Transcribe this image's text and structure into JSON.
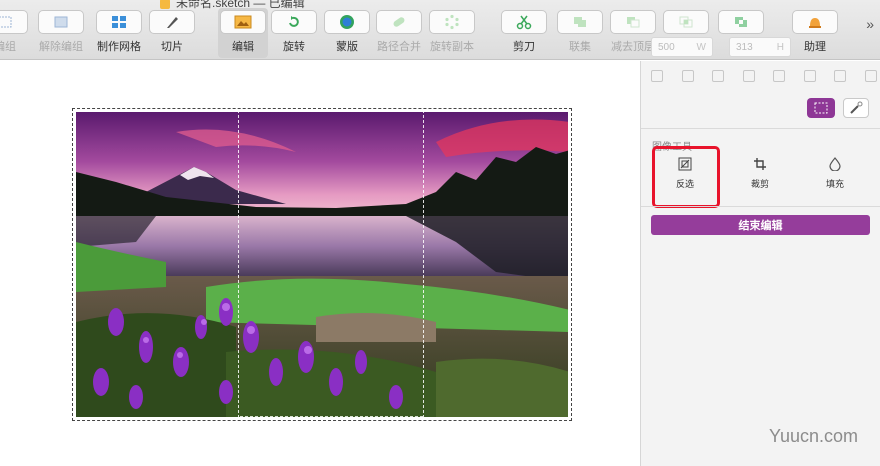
{
  "window": {
    "title_fragment": "未命名.sketch — 已编辑"
  },
  "toolbar": {
    "items": [
      {
        "label": "编组",
        "state": "disabled"
      },
      {
        "label": "解除编组",
        "state": "disabled"
      },
      {
        "label": "制作网格",
        "state": "normal"
      },
      {
        "label": "切片",
        "state": "normal"
      },
      {
        "label": "编辑",
        "state": "selected"
      },
      {
        "label": "旋转",
        "state": "normal"
      },
      {
        "label": "蒙版",
        "state": "normal"
      },
      {
        "label": "路径合并",
        "state": "disabled"
      },
      {
        "label": "旋转副本",
        "state": "disabled"
      },
      {
        "label": "剪刀",
        "state": "normal"
      },
      {
        "label": "联集",
        "state": "disabled"
      },
      {
        "label": "减去顶层",
        "state": "disabled"
      },
      {
        "label": "交集",
        "state": "disabled"
      },
      {
        "label": "差集",
        "state": "disabled"
      },
      {
        "label": "助理",
        "state": "normal"
      }
    ],
    "more_label": "»"
  },
  "inspector": {
    "width_value": "500",
    "width_unit": "W",
    "height_value": "313",
    "height_unit": "H",
    "image_tools_title": "图像工具",
    "tools": [
      {
        "label": "反选",
        "icon": "invert-selection-icon"
      },
      {
        "label": "裁剪",
        "icon": "crop-icon"
      },
      {
        "label": "填充",
        "icon": "fill-drop-icon"
      }
    ],
    "end_edit_label": "结束编辑"
  },
  "watermark": "Yuucn.com",
  "colors": {
    "accent_purple": "#953d9b",
    "highlight_red": "#e8132b"
  }
}
